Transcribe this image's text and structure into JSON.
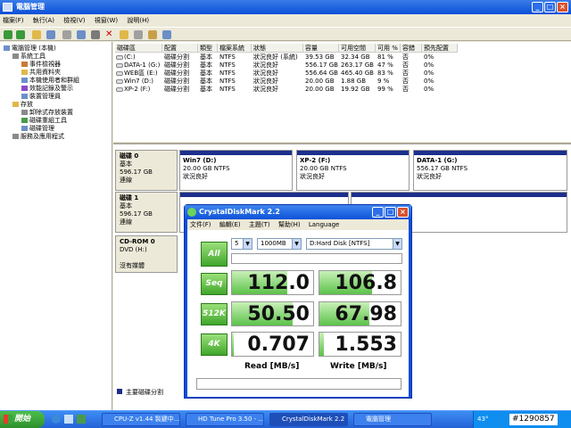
{
  "window": {
    "title": "電腦管理"
  },
  "menu": [
    "檔案(F)",
    "執行(A)",
    "檢視(V)",
    "視窗(W)",
    "說明(H)"
  ],
  "tree": [
    {
      "label": "電腦管理 (本機)",
      "level": 0
    },
    {
      "label": "系統工具",
      "level": 1
    },
    {
      "label": "事件檢視器",
      "level": 2
    },
    {
      "label": "共用資料夾",
      "level": 2
    },
    {
      "label": "本機使用者和群組",
      "level": 2
    },
    {
      "label": "效能記錄及警示",
      "level": 2
    },
    {
      "label": "裝置管理員",
      "level": 2
    },
    {
      "label": "存放",
      "level": 1
    },
    {
      "label": "卸除式存放裝置",
      "level": 2
    },
    {
      "label": "磁碟重組工具",
      "level": 2
    },
    {
      "label": "磁碟管理",
      "level": 2
    },
    {
      "label": "服務及應用程式",
      "level": 1
    }
  ],
  "volumes": {
    "headers": [
      "磁碟區",
      "配置",
      "類型",
      "檔案系統",
      "狀態",
      "容量",
      "可用空間",
      "可用 %",
      "容錯",
      "預先配置"
    ],
    "rows": [
      [
        "(C:)",
        "磁碟分割",
        "基本",
        "NTFS",
        "狀況良好 (系統)",
        "39.53 GB",
        "32.34 GB",
        "81 %",
        "否",
        "0%"
      ],
      [
        "DATA-1 (G:)",
        "磁碟分割",
        "基本",
        "NTFS",
        "狀況良好",
        "556.17 GB",
        "263.17 GB",
        "47 %",
        "否",
        "0%"
      ],
      [
        "WEB區 (E:)",
        "磁碟分割",
        "基本",
        "NTFS",
        "狀況良好",
        "556.64 GB",
        "465.40 GB",
        "83 %",
        "否",
        "0%"
      ],
      [
        "Win7 (D:)",
        "磁碟分割",
        "基本",
        "NTFS",
        "狀況良好",
        "20.00 GB",
        "1.88 GB",
        "9 %",
        "否",
        "0%"
      ],
      [
        "XP-2 (F:)",
        "磁碟分割",
        "基本",
        "NTFS",
        "狀況良好",
        "20.00 GB",
        "19.92 GB",
        "99 %",
        "否",
        "0%"
      ]
    ]
  },
  "disks": [
    {
      "name": "磁碟 0",
      "type": "基本",
      "size": "596.17 GB",
      "status": "連線",
      "parts": [
        {
          "name": "Win7  (D:)",
          "size": "20.00 GB NTFS",
          "status": "狀況良好"
        },
        {
          "name": "XP-2  (F:)",
          "size": "20.00 GB NTFS",
          "status": "狀況良好"
        },
        {
          "name": "DATA-1  (G:)",
          "size": "556.17 GB NTFS",
          "status": "狀況良好"
        }
      ]
    },
    {
      "name": "磁碟 1",
      "type": "基本",
      "size": "596.17 GB",
      "status": "連線"
    },
    {
      "name": "CD-ROM 0",
      "type": "DVD (H:)",
      "size": "",
      "status": "沒有媒體"
    }
  ],
  "legend": "主要磁碟分割",
  "cdm": {
    "title": "CrystalDiskMark 2.2",
    "menu": [
      "文件(F)",
      "編輯(E)",
      "主題(T)",
      "幫助(H)",
      "Language"
    ],
    "runs": "5",
    "size": "1000MB",
    "drive": "D:Hard Disk [NTFS]",
    "all_label": "All",
    "rows": [
      {
        "label": "Seq",
        "read": "112.0",
        "write": "106.8",
        "read_frac": 0.68,
        "write_frac": 0.65
      },
      {
        "label": "512K",
        "read": "50.50",
        "write": "67.98",
        "read_frac": 0.75,
        "write_frac": 0.62
      },
      {
        "label": "4K",
        "read": "0.707",
        "write": "1.553",
        "read_frac": 0.02,
        "write_frac": 0.06
      }
    ],
    "read_label": "Read [MB/s]",
    "write_label": "Write [MB/s]"
  },
  "taskbar": {
    "start": "開始",
    "tasks": [
      "CPU-Z v1.44 製鍵中...",
      "HD Tune Pro 3.50 - ...",
      "CrystalDiskMark 2.2",
      "電腦管理"
    ],
    "tray": "#1290857",
    "temp": "43°"
  }
}
